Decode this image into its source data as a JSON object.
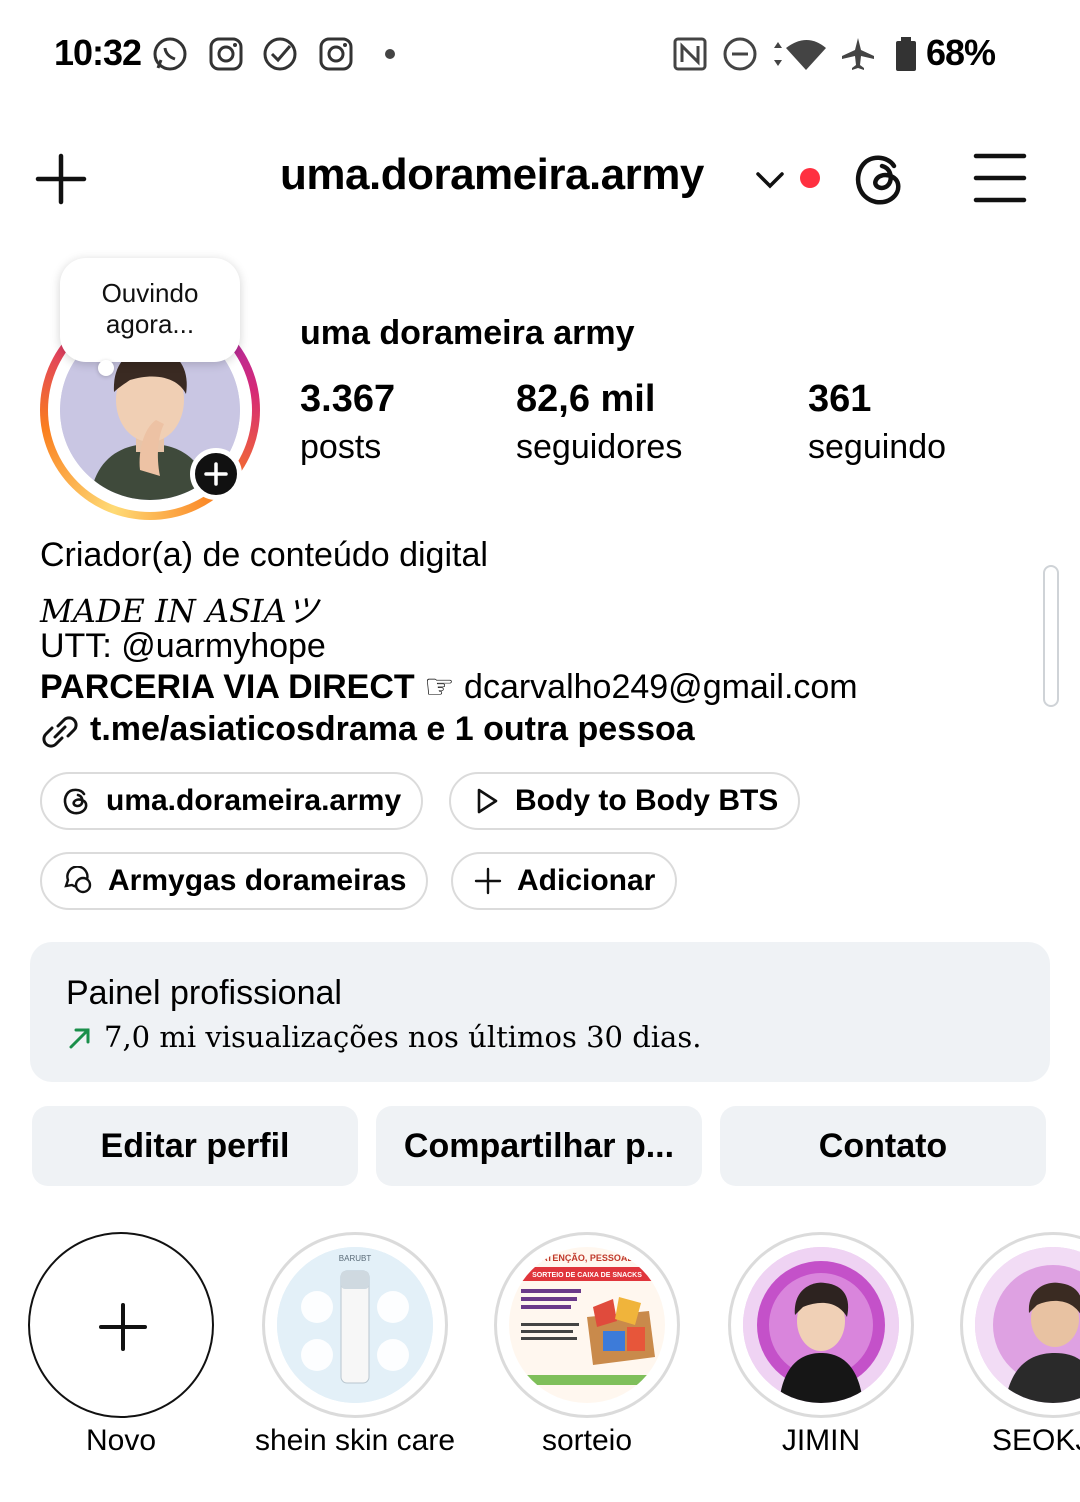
{
  "status_bar": {
    "time": "10:32",
    "battery": "68%",
    "left_icons": [
      "whatsapp-icon",
      "instagram-icon",
      "check-circle-icon",
      "instagram-icon",
      "dot-icon"
    ],
    "right_icons": [
      "nfc-icon",
      "do-not-disturb-icon",
      "data-arrows-icon",
      "wifi-icon",
      "airplane-icon",
      "battery-icon"
    ]
  },
  "header": {
    "username": "uma.dorameira.army",
    "icons": [
      "plus-icon",
      "chevron-down-icon",
      "notification-dot",
      "threads-icon",
      "menu-icon"
    ],
    "accent_red": "#ff3040"
  },
  "profile": {
    "note": "Ouvindo agora...",
    "note_line1": "Ouvindo",
    "note_line2": "agora...",
    "display_name": "uma dorameira army",
    "stats": [
      {
        "value": "3.367",
        "label": "posts"
      },
      {
        "value": "82,6 mil",
        "label": "seguidores"
      },
      {
        "value": "361",
        "label": "seguindo"
      }
    ]
  },
  "bio": {
    "category": "Criador(a) de conteúdo digital",
    "line1": "𝑀𝐴𝐷𝐸 𝐼𝑁 𝐴𝑆𝐼𝐴ツ",
    "line2": "UTT: @uarmyhope",
    "partner_bold": "PARCERIA VIA DIRECT",
    "partner_rest": "☞ dcarvalho249@gmail.com",
    "link": "t.me/asiaticosdrama e 1 outra pessoa"
  },
  "chips": [
    {
      "label": "uma.dorameira.army",
      "icon": "threads-icon"
    },
    {
      "label": "Body to Body BTS",
      "icon": "play-icon"
    },
    {
      "label": "Armygas dorameiras",
      "icon": "chat-icon"
    },
    {
      "label": "Adicionar",
      "icon": "plus-icon"
    }
  ],
  "dashboard": {
    "title": "Painel profissional",
    "subtitle": "7,0 mi visualizações nos últimos 30 dias.",
    "trend_color": "#1a8f4a"
  },
  "buttons": [
    "Editar perfil",
    "Compartilhar p...",
    "Contato"
  ],
  "highlights": [
    {
      "label": "Novo"
    },
    {
      "label": "shein skin care"
    },
    {
      "label": "sorteio"
    },
    {
      "label": "JIMIN"
    },
    {
      "label": "SEOKJIN"
    }
  ],
  "highlight_texts": {
    "skin_care_brand": "BARUBT",
    "sorteio_header": "SORTEIO DE CAIXA DE SNACKS",
    "sorteio_top": "ATENÇÃO, PESSOAL"
  }
}
